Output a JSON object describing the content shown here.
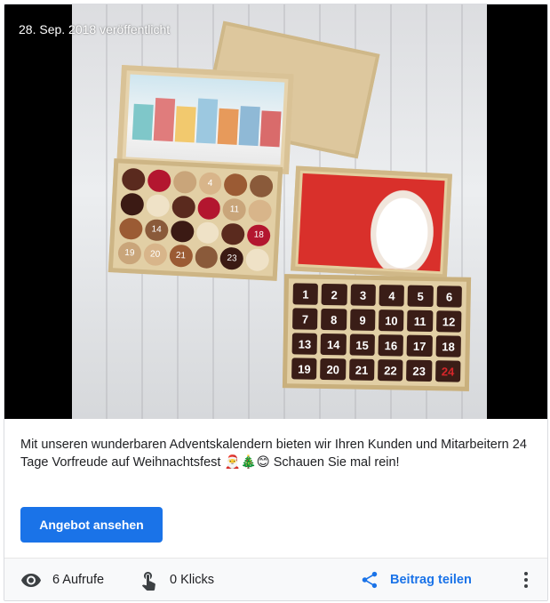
{
  "post": {
    "date_overlay": "28. Sep. 2018 veröffentlicht",
    "image_alt": "Adventskalender Pralinen",
    "text": "Mit unseren wunderbaren Adventskalendern bieten wir Ihren Kunden und Mitarbeitern 24 Tage Vorfreude auf Weihnachtsfest 🎅🎄😊 Schauen Sie mal rein!",
    "cta_label": "Angebot ansehen"
  },
  "footer": {
    "views": "6 Aufrufe",
    "clicks": "0 Klicks",
    "share_label": "Beitrag teilen"
  },
  "icons": {
    "views": "eye-icon",
    "clicks": "touch-icon",
    "share": "share-icon",
    "more": "more-vert-icon"
  },
  "colors": {
    "accent": "#1a73e8",
    "text": "#202124",
    "footer_bg": "#f8f9fa"
  },
  "calendar_numbers": [
    "1",
    "2",
    "3",
    "4",
    "5",
    "6",
    "7",
    "8",
    "9",
    "10",
    "11",
    "12",
    "13",
    "14",
    "15",
    "16",
    "17",
    "18",
    "19",
    "20",
    "21",
    "22",
    "23",
    "24"
  ],
  "box1_numbers": [
    "",
    "",
    "",
    "4",
    "",
    "",
    "",
    "",
    "",
    "",
    "11",
    "",
    "",
    "14",
    "",
    "",
    "",
    "18",
    "19",
    "20",
    "21",
    "",
    "23",
    ""
  ]
}
